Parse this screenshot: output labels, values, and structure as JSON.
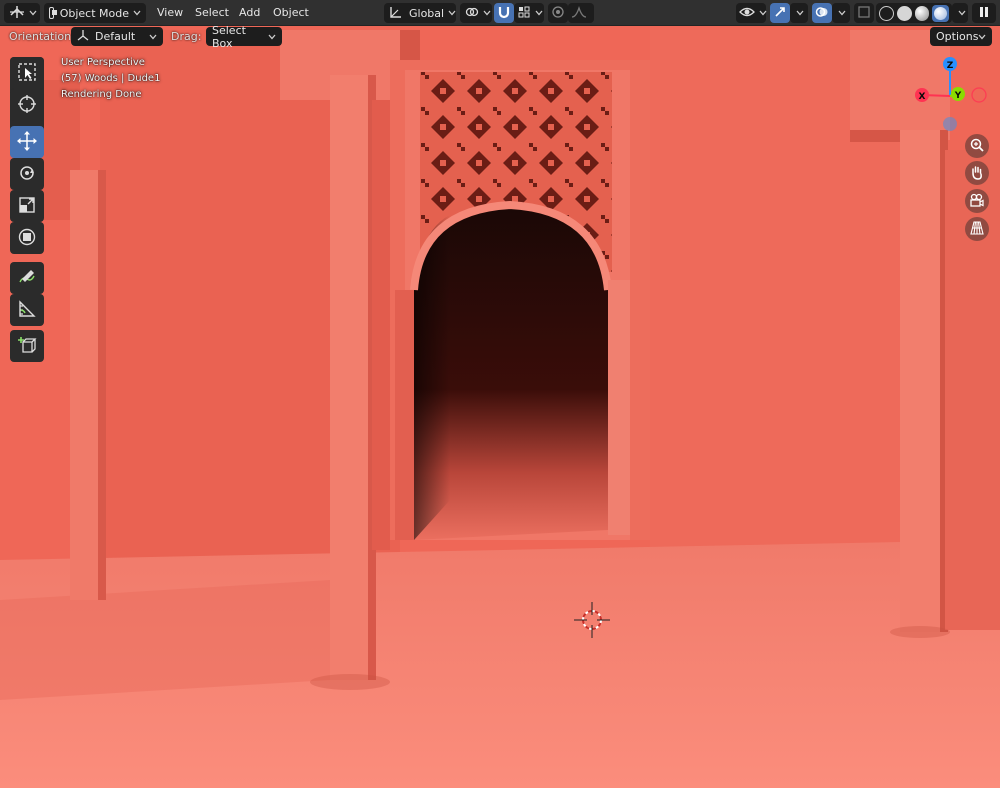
{
  "header": {
    "mode_label": "Object Mode",
    "menus": [
      "View",
      "Select",
      "Add",
      "Object"
    ],
    "transform_orientation": "Global"
  },
  "tool_settings": {
    "orientation_label": "Orientation:",
    "orientation_value": "Default",
    "drag_label": "Drag:",
    "drag_value": "Select Box",
    "options_label": "Options"
  },
  "viewport_overlay": {
    "view_name": "User Perspective",
    "object_info": "(57) Woods | Dude1",
    "status": "Rendering Done"
  },
  "gizmo": {
    "x_label": "X",
    "y_label": "Y",
    "z_label": "Z"
  },
  "colors": {
    "accent": "#4772b3",
    "render_tint": "#f06a58",
    "axis_x": "#ff3352",
    "axis_y": "#8bdc00",
    "axis_z": "#2890ff"
  },
  "icons": {
    "editor_type": "editor-type-icon",
    "mode": "object-mode-icon",
    "orientation": "transform-orientation-icon",
    "pivot": "pivot-point-icon",
    "snap": "snap-magnet-icon",
    "snap_target": "snap-increment-icon",
    "proportional": "proportional-editing-icon",
    "falloff": "falloff-icon",
    "visibility": "visibility-eye-icon",
    "gizmo": "gizmo-arrows-icon",
    "overlays": "overlays-icon",
    "xray": "xray-icon",
    "shading_wire": "wireframe-shading-icon",
    "shading_solid": "solid-shading-icon",
    "shading_material": "material-preview-icon",
    "shading_rendered": "rendered-shading-icon",
    "pause": "pause-icon"
  }
}
